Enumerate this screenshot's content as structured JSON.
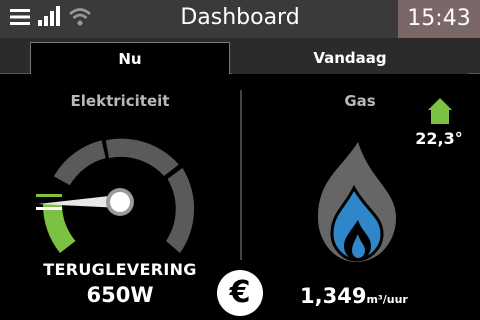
{
  "header": {
    "title": "Dashboard",
    "time": "15:43",
    "icons": [
      "menu-icon",
      "signal-icon",
      "wifi-icon"
    ]
  },
  "tabs": [
    {
      "label": "Nu",
      "active": true
    },
    {
      "label": "Vandaag",
      "active": false
    }
  ],
  "electricity": {
    "title": "Elektriciteit",
    "mode": "TERUGLEVERING",
    "value": "650W"
  },
  "gas": {
    "title": "Gas",
    "indoor_temp": "22,3°",
    "flow_value": "1,349",
    "flow_unit": "m³/uur"
  },
  "actions": {
    "currency_symbol": "€"
  },
  "colors": {
    "accent_green": "#7cc242",
    "flame_blue": "#2f86c9",
    "gauge_gray": "#5a5a5a",
    "clock_bg": "#7a6767"
  }
}
